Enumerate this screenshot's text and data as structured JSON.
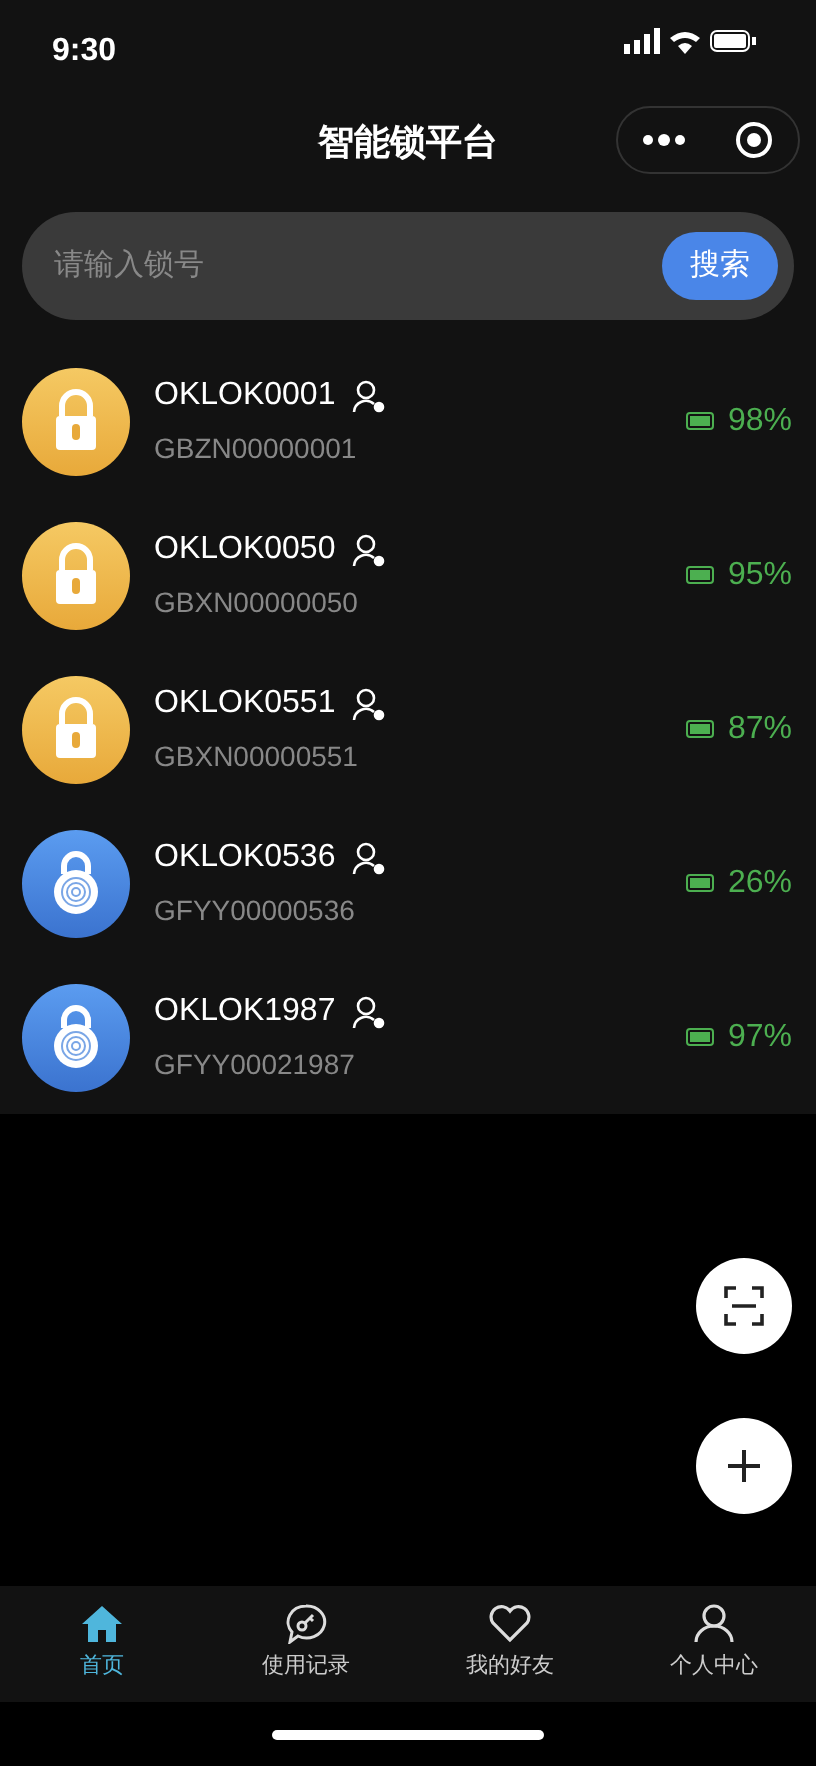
{
  "status_bar": {
    "time": "9:30"
  },
  "nav_bar": {
    "title": "智能锁平台"
  },
  "search": {
    "placeholder": "请输入锁号",
    "button": "搜索"
  },
  "locks": [
    {
      "kind": "padlock",
      "name": "OKLOK0001",
      "serial": "GBZN00000001",
      "battery": "98%"
    },
    {
      "kind": "padlock",
      "name": "OKLOK0050",
      "serial": "GBXN00000050",
      "battery": "95%"
    },
    {
      "kind": "padlock",
      "name": "OKLOK0551",
      "serial": "GBXN00000551",
      "battery": "87%"
    },
    {
      "kind": "fingerprint",
      "name": "OKLOK0536",
      "serial": "GFYY00000536",
      "battery": "26%"
    },
    {
      "kind": "fingerprint",
      "name": "OKLOK1987",
      "serial": "GFYY00021987",
      "battery": "97%"
    }
  ],
  "tabs": [
    {
      "kind": "home",
      "label": "首页",
      "selected": true
    },
    {
      "kind": "records",
      "label": "使用记录",
      "selected": false
    },
    {
      "kind": "friends",
      "label": "我的好友",
      "selected": false
    },
    {
      "kind": "profile",
      "label": "个人中心",
      "selected": false
    }
  ]
}
